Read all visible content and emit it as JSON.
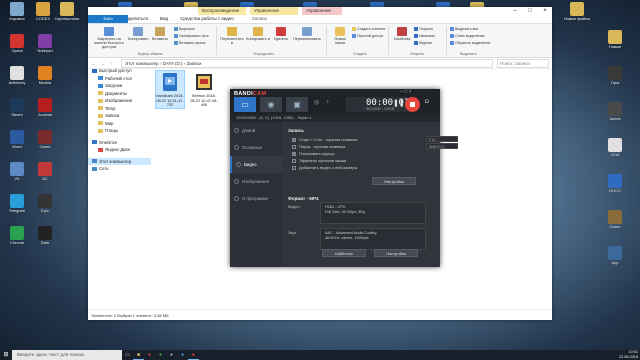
{
  "desktop": {
    "icons": [
      {
        "label": "Корзина",
        "color": "#7fa7c9"
      },
      {
        "label": "CODEX",
        "color": "#d9a441"
      },
      {
        "label": "Скриншотики",
        "color": "#d9b85a"
      },
      {
        "label": "Новая",
        "color": "#2d6cc0"
      },
      {
        "label": "Редактировать",
        "color": "#d9b85a"
      },
      {
        "label": "Новый",
        "color": "#2d6cc0"
      },
      {
        "label": "DOCX",
        "color": "#2d6cc0"
      },
      {
        "label": "DOCX",
        "color": "#2d6cc0"
      },
      {
        "label": "DOCX",
        "color": "#2d6cc0"
      },
      {
        "label": "Новые",
        "color": "#d9b85a"
      },
      {
        "label": "Новые файлы",
        "color": "#d9b85a"
      }
    ],
    "left_icons": [
      {
        "label": "Opera",
        "color": "#d3342e"
      },
      {
        "label": "Notepad",
        "color": "#7f3fa6"
      },
      {
        "label": "ArtMoney",
        "color": "#e0e0e0"
      },
      {
        "label": "Mozilla",
        "color": "#e0821f"
      },
      {
        "label": "Steam",
        "color": "#1d3a5a"
      },
      {
        "label": "Acrobat",
        "color": "#b41e1e"
      },
      {
        "label": "Word",
        "color": "#2c5aa0"
      },
      {
        "label": "Game",
        "color": "#7a2a2a"
      },
      {
        "label": "VK",
        "color": "#5d8ac3"
      },
      {
        "label": "AC",
        "color": "#c23838"
      },
      {
        "label": "Telegram",
        "color": "#2a9ed9"
      },
      {
        "label": "Epic",
        "color": "#333333"
      },
      {
        "label": "Chrome",
        "color": "#2aa14f"
      },
      {
        "label": "Dark",
        "color": "#222222"
      }
    ],
    "right_icons": [
      {
        "label": "Новые",
        "color": "#d9b85a"
      },
      {
        "label": "Пуск",
        "color": "#3a3a3a"
      },
      {
        "label": "Ashes",
        "color": "#4a4a4a"
      },
      {
        "label": "2018",
        "color": "#e0e0e0"
      },
      {
        "label": "DOCX",
        "color": "#2d6cc0"
      },
      {
        "label": "Game",
        "color": "#8a6b3a"
      },
      {
        "label": "App",
        "color": "#3b6a9a"
      }
    ]
  },
  "explorer": {
    "title": "Записи",
    "contexts": [
      "Воспроизведение",
      "Управление",
      "Управление"
    ],
    "tabs": [
      "Файл",
      "Главная",
      "Поделиться",
      "Вид",
      "Средства работы с видео"
    ],
    "ribbon": {
      "pin": "Закрепить на панели быстрого доступа",
      "copy": "Копировать",
      "paste": "Вставить",
      "cut": "Вырезать",
      "copy_path": "Скопировать путь",
      "paste_shortcut": "Вставить ярлык",
      "group_clipboard": "Буфер обмена",
      "move": "Переместить в",
      "copy_to": "Копировать в",
      "delete": "Удалить",
      "rename": "Переименовать",
      "group_organize": "Упорядочить",
      "new_folder": "Новая папка",
      "new_item": "Создать элемент",
      "easy_access": "Простой доступ",
      "group_create": "Создать",
      "properties": "Свойства",
      "open": "Открыть",
      "edit": "Изменить",
      "journal": "Журнал",
      "group_open": "Открыть",
      "select_all": "Выделить все",
      "select_none": "Снять выделение",
      "invert": "Обратить выделение",
      "group_select": "Выделить"
    },
    "address": "Этот компьютер › DATA (D:) › Записи",
    "search_placeholder": "Поиск: Записи",
    "nav": [
      {
        "label": "Быстрый доступ",
        "color": "#2d6cc0"
      },
      {
        "label": "Рабочий стол",
        "color": "#3a8ad6"
      },
      {
        "label": "Загрузки",
        "color": "#3a8ad6"
      },
      {
        "label": "Документы",
        "color": "#e8c15a"
      },
      {
        "label": "Изображения",
        "color": "#e8c15a"
      },
      {
        "label": "Temp",
        "color": "#e8c15a"
      },
      {
        "label": "Записи",
        "color": "#e8c15a"
      },
      {
        "label": "Мир",
        "color": "#e8c15a"
      },
      {
        "label": "Птицы",
        "color": "#e8c15a"
      },
      {
        "label": "OneDrive",
        "color": "#2f74c8"
      },
      {
        "label": "Яндекс.Диск",
        "color": "#d44"
      },
      {
        "label": "Этот компьютер",
        "color": "#4b88c8"
      },
      {
        "label": "Сеть",
        "color": "#4b88c8"
      }
    ],
    "files": [
      {
        "name": "bandicam 2018-08-22 10-51-41-722",
        "type": "video"
      },
      {
        "name": "Beehon 2018-08-22 10-47-08-406",
        "type": "film"
      }
    ],
    "status": "Элементов: 2    Выбран 1 элемент: 3,58 МБ"
  },
  "bandicam": {
    "logo_a": "BANDI",
    "logo_b": "CAM",
    "time": "00:00:01",
    "size": "383,6KB / 4,8GB",
    "info": "1920x1080 - (0, 0), (1919, 1080) - Экран 1",
    "sidebar": [
      "Домой",
      "Основные",
      "Видео",
      "Изображения",
      "О программе"
    ],
    "record": {
      "title": "Запись",
      "rows": [
        {
          "label": "Старт / Стоп - горячая клавиша",
          "checked": true,
          "value": "F12"
        },
        {
          "label": "Пауза - горячая клавиша",
          "checked": false,
          "value": "Shift+F12"
        },
        {
          "label": "Показывать курсор",
          "checked": true,
          "value": ""
        },
        {
          "label": "Эффекты щелчков мыши",
          "checked": false,
          "value": ""
        },
        {
          "label": "Добавлять видео с веб-камеры",
          "checked": false,
          "value": ""
        }
      ],
      "settings_btn": "Настройки"
    },
    "format": {
      "title": "Формат - MP4",
      "video_label": "Видео",
      "video_lines": [
        "H264 - CPU",
        "Full Size, 30.00fps, 80q"
      ],
      "audio_label": "Звук",
      "audio_lines": [
        "AAC - Advanced Audio Coding",
        "48.0KHz, stereo, 192kbps"
      ],
      "templates_btn": "Шаблоны",
      "settings_btn": "Настройки"
    }
  },
  "taskbar": {
    "search": "Введите здесь текст для поиска",
    "time": "10:51",
    "date": "22.08.2018"
  }
}
